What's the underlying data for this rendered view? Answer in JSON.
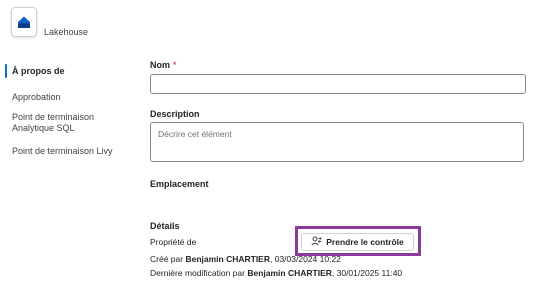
{
  "item": {
    "name": "Lakehouse",
    "icon": "lakehouse-icon",
    "accent": "#0f6cbd"
  },
  "nav": {
    "items": [
      {
        "label": "À propos de",
        "active": true
      },
      {
        "label": "Approbation"
      },
      {
        "label": "Point de terminaison Analytique SQL"
      },
      {
        "label": "Point de terminaison Livy"
      }
    ]
  },
  "form": {
    "name_label": "Nom",
    "required_mark": "*",
    "name_value": "",
    "description_label": "Description",
    "description_placeholder": "Décrire cet élément",
    "location_label": "Emplacement"
  },
  "details": {
    "heading": "Détails",
    "ownership_label": "Propriété de",
    "take_control_button": "Prendre le contrôle",
    "take_control_icon": "person-swap-icon",
    "created_prefix": "Créé par",
    "created_by": "Benjamin CHARTIER",
    "created_date": ", 03/03/2024 10:22",
    "modified_prefix": "Dernière modification par",
    "modified_by": "Benjamin CHARTIER",
    "modified_date": ", 30/01/2025 11:40",
    "highlight_color": "#8b3a9c"
  }
}
